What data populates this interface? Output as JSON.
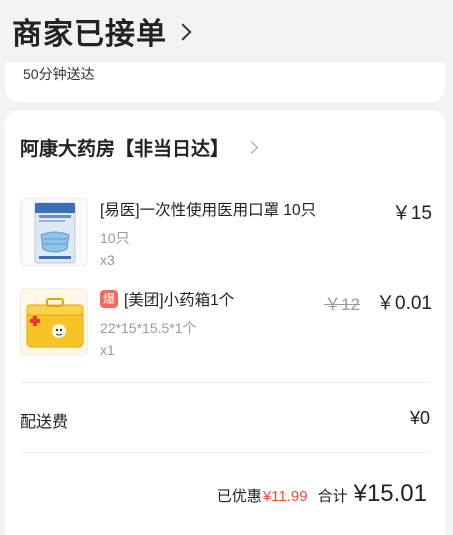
{
  "header": {
    "status_title": "商家已接单"
  },
  "delivery": {
    "eta": "50分钟送达"
  },
  "shop": {
    "name": "阿康大药房【非当日达】"
  },
  "items": [
    {
      "name": "[易医]一次性使用医用口罩 10只",
      "spec": "10只",
      "qty": "x3",
      "price": "￥15",
      "image_icon": "mask-package-icon"
    },
    {
      "badge": "爆",
      "name": "[美团]小药箱1个",
      "spec": "22*15*15.5*1个",
      "qty": "x1",
      "original_price": "￥12",
      "price": "￥0.01",
      "image_icon": "first-aid-box-icon"
    }
  ],
  "fees": {
    "delivery_label": "配送费",
    "delivery_value": "¥0"
  },
  "summary": {
    "saved_label": "已优惠",
    "saved_value": "¥11.99",
    "total_label": "合计",
    "total_value": "¥15.01"
  },
  "colors": {
    "accent_red": "#f04b3a",
    "badge_red": "#f06a5a",
    "background": "#f3f3f3"
  }
}
